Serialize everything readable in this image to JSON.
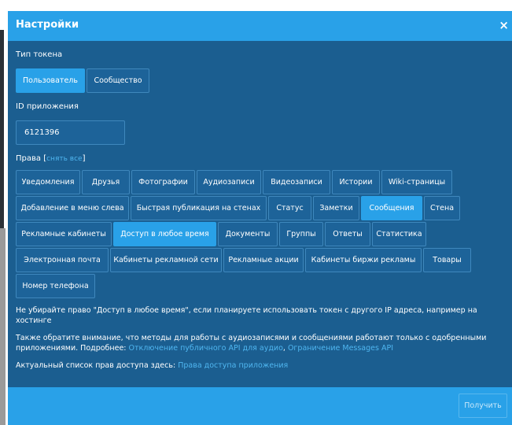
{
  "dialog": {
    "title": "Настройки",
    "close_symbol": "×"
  },
  "token_type": {
    "label": "Тип токена",
    "options": [
      "Пользователь",
      "Сообщество"
    ]
  },
  "app_id": {
    "label": "ID приложения",
    "value": "6121396"
  },
  "rights": {
    "label_prefix": "Права [",
    "clear_link": "снять все",
    "label_suffix": "]",
    "rows": [
      [
        "Уведомления",
        "Друзья",
        "Фотографии",
        "Аудиозаписи",
        "Видеозаписи",
        "Истории",
        "Wiki-страницы"
      ],
      [
        "Добавление в меню слева",
        "Быстрая публикация на стенах",
        "Статус",
        "Заметки",
        "Сообщения",
        "Стена"
      ],
      [
        "Рекламные кабинеты",
        "Доступ в любое время",
        "Документы",
        "Группы",
        "Ответы",
        "Статистика"
      ],
      [
        "Электронная почта",
        "Кабинеты рекламной сети",
        "Рекламные акции",
        "Кабинеты биржи рекламы",
        "Товары"
      ],
      [
        "Номер телефона"
      ]
    ],
    "active": [
      "Сообщения",
      "Доступ в любое время"
    ]
  },
  "notes": {
    "warning": "Не убирайте право \"Доступ в любое время\", если планируете использовать токен с другого IP адреса, например на хостинге",
    "attention": "Также обратите внимание, что методы для работы с аудиозаписями и сообщениями работают только с одобренными приложениями. Подробнее:",
    "link_audio": "Отключение публичного API для аудио",
    "separator": ", ",
    "link_messages": "Ограничение Messages API",
    "actual_list": "Актуальный список прав доступа здесь:",
    "link_rights": "Права доступа приложения"
  },
  "footer": {
    "submit_label": "Получить"
  },
  "colors": {
    "header": "#29a1e8",
    "body": "#1b5e90",
    "button": "#1d6399",
    "button_active": "#29a1e8",
    "link": "#4fb6f0"
  }
}
